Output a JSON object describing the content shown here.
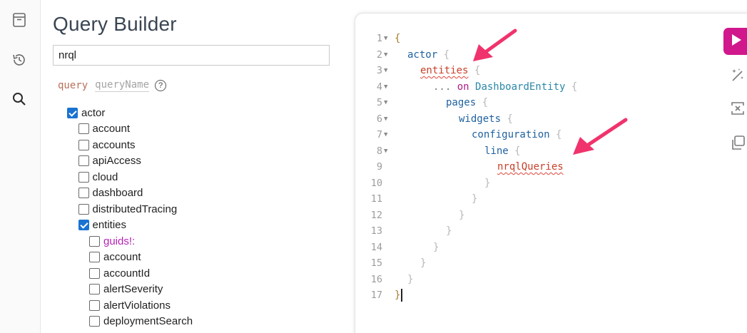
{
  "rail": {
    "icons": [
      "history-panel-icon",
      "history-icon",
      "search-icon"
    ]
  },
  "explorer": {
    "title": "Query Builder",
    "search_value": "nrql",
    "operation_kind": "query",
    "operation_name": "queryName",
    "help": "?",
    "tree": [
      {
        "label": "actor",
        "checked": true,
        "level": 0,
        "arg": false
      },
      {
        "label": "account",
        "checked": false,
        "level": 1,
        "arg": false
      },
      {
        "label": "accounts",
        "checked": false,
        "level": 1,
        "arg": false
      },
      {
        "label": "apiAccess",
        "checked": false,
        "level": 1,
        "arg": false
      },
      {
        "label": "cloud",
        "checked": false,
        "level": 1,
        "arg": false
      },
      {
        "label": "dashboard",
        "checked": false,
        "level": 1,
        "arg": false
      },
      {
        "label": "distributedTracing",
        "checked": false,
        "level": 1,
        "arg": false
      },
      {
        "label": "entities",
        "checked": true,
        "level": 1,
        "arg": false
      },
      {
        "label": "guids!:",
        "checked": false,
        "level": 2,
        "arg": true
      },
      {
        "label": "account",
        "checked": false,
        "level": 2,
        "arg": false
      },
      {
        "label": "accountId",
        "checked": false,
        "level": 2,
        "arg": false
      },
      {
        "label": "alertSeverity",
        "checked": false,
        "level": 2,
        "arg": false
      },
      {
        "label": "alertViolations",
        "checked": false,
        "level": 2,
        "arg": false
      },
      {
        "label": "deploymentSearch",
        "checked": false,
        "level": 2,
        "arg": false
      }
    ]
  },
  "editor": {
    "lines": [
      {
        "n": "1",
        "fold": true,
        "indent": 0,
        "tokens": [
          {
            "t": "{",
            "c": "t-brace outer"
          }
        ]
      },
      {
        "n": "2",
        "fold": true,
        "indent": 1,
        "tokens": [
          {
            "t": "actor",
            "c": "t-field"
          },
          {
            "t": " {",
            "c": "t-brace"
          }
        ]
      },
      {
        "n": "3",
        "fold": true,
        "indent": 2,
        "tokens": [
          {
            "t": "entities",
            "c": "t-err"
          },
          {
            "t": " {",
            "c": "t-brace"
          }
        ]
      },
      {
        "n": "4",
        "fold": true,
        "indent": 3,
        "tokens": [
          {
            "t": "... ",
            "c": "t-punc"
          },
          {
            "t": "on ",
            "c": "t-kw"
          },
          {
            "t": "DashboardEntity",
            "c": "t-type"
          },
          {
            "t": " {",
            "c": "t-brace"
          }
        ]
      },
      {
        "n": "5",
        "fold": true,
        "indent": 4,
        "tokens": [
          {
            "t": "pages",
            "c": "t-field"
          },
          {
            "t": " {",
            "c": "t-brace"
          }
        ]
      },
      {
        "n": "6",
        "fold": true,
        "indent": 5,
        "tokens": [
          {
            "t": "widgets",
            "c": "t-field"
          },
          {
            "t": " {",
            "c": "t-brace"
          }
        ]
      },
      {
        "n": "7",
        "fold": true,
        "indent": 6,
        "tokens": [
          {
            "t": "configuration",
            "c": "t-field"
          },
          {
            "t": " {",
            "c": "t-brace"
          }
        ]
      },
      {
        "n": "8",
        "fold": true,
        "indent": 7,
        "tokens": [
          {
            "t": "line",
            "c": "t-field"
          },
          {
            "t": " {",
            "c": "t-brace"
          }
        ]
      },
      {
        "n": "9",
        "fold": false,
        "indent": 8,
        "tokens": [
          {
            "t": "nrqlQueries",
            "c": "t-err"
          }
        ]
      },
      {
        "n": "10",
        "fold": false,
        "indent": 7,
        "tokens": [
          {
            "t": "}",
            "c": "t-brace"
          }
        ]
      },
      {
        "n": "11",
        "fold": false,
        "indent": 6,
        "tokens": [
          {
            "t": "}",
            "c": "t-brace"
          }
        ]
      },
      {
        "n": "12",
        "fold": false,
        "indent": 5,
        "tokens": [
          {
            "t": "}",
            "c": "t-brace"
          }
        ]
      },
      {
        "n": "13",
        "fold": false,
        "indent": 4,
        "tokens": [
          {
            "t": "}",
            "c": "t-brace"
          }
        ]
      },
      {
        "n": "14",
        "fold": false,
        "indent": 3,
        "tokens": [
          {
            "t": "}",
            "c": "t-brace"
          }
        ]
      },
      {
        "n": "15",
        "fold": false,
        "indent": 2,
        "tokens": [
          {
            "t": "}",
            "c": "t-brace"
          }
        ]
      },
      {
        "n": "16",
        "fold": false,
        "indent": 1,
        "tokens": [
          {
            "t": "}",
            "c": "t-brace"
          }
        ]
      },
      {
        "n": "17",
        "fold": false,
        "indent": 0,
        "tokens": [
          {
            "t": "}",
            "c": "t-brace outer"
          }
        ],
        "cursor": true
      }
    ]
  },
  "toolbar": {
    "icons": [
      "run-query-icon",
      "prettify-icon",
      "merge-fragments-icon",
      "copy-query-icon"
    ]
  },
  "colors": {
    "accent": "#d0178c",
    "checkbox_checked": "#1a73d1",
    "annotation_arrow": "#f0336c"
  }
}
